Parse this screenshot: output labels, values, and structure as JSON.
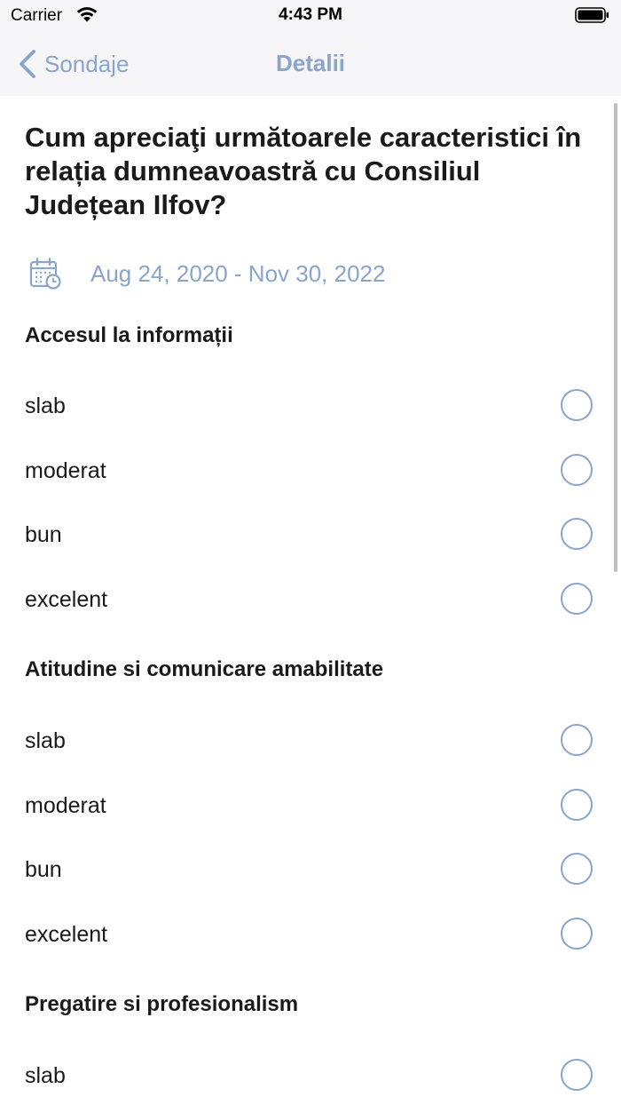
{
  "status_bar": {
    "carrier": "Carrier",
    "time": "4:43 PM",
    "wifi_icon": "wifi-icon",
    "battery_icon": "battery-full-icon"
  },
  "nav": {
    "back_label": "Sondaje",
    "title": "Detalii",
    "accent_color": "#8aa4cb"
  },
  "survey": {
    "question": "Cum apreciaţi următoarele caracteristici în relația dumneavoastră cu Consiliul Județean Ilfov?",
    "date_range": "Aug 24, 2020 - Nov 30, 2022",
    "date_icon": "calendar-clock-icon",
    "sections": [
      {
        "title": "Accesul la informații",
        "options": [
          {
            "label": "slab",
            "selected": false
          },
          {
            "label": "moderat",
            "selected": false
          },
          {
            "label": "bun",
            "selected": false
          },
          {
            "label": "excelent",
            "selected": false
          }
        ]
      },
      {
        "title": "Atitudine si comunicare amabilitate",
        "options": [
          {
            "label": "slab",
            "selected": false
          },
          {
            "label": "moderat",
            "selected": false
          },
          {
            "label": "bun",
            "selected": false
          },
          {
            "label": "excelent",
            "selected": false
          }
        ]
      },
      {
        "title": "Pregatire si profesionalism",
        "options": [
          {
            "label": "slab",
            "selected": false
          }
        ]
      }
    ]
  }
}
